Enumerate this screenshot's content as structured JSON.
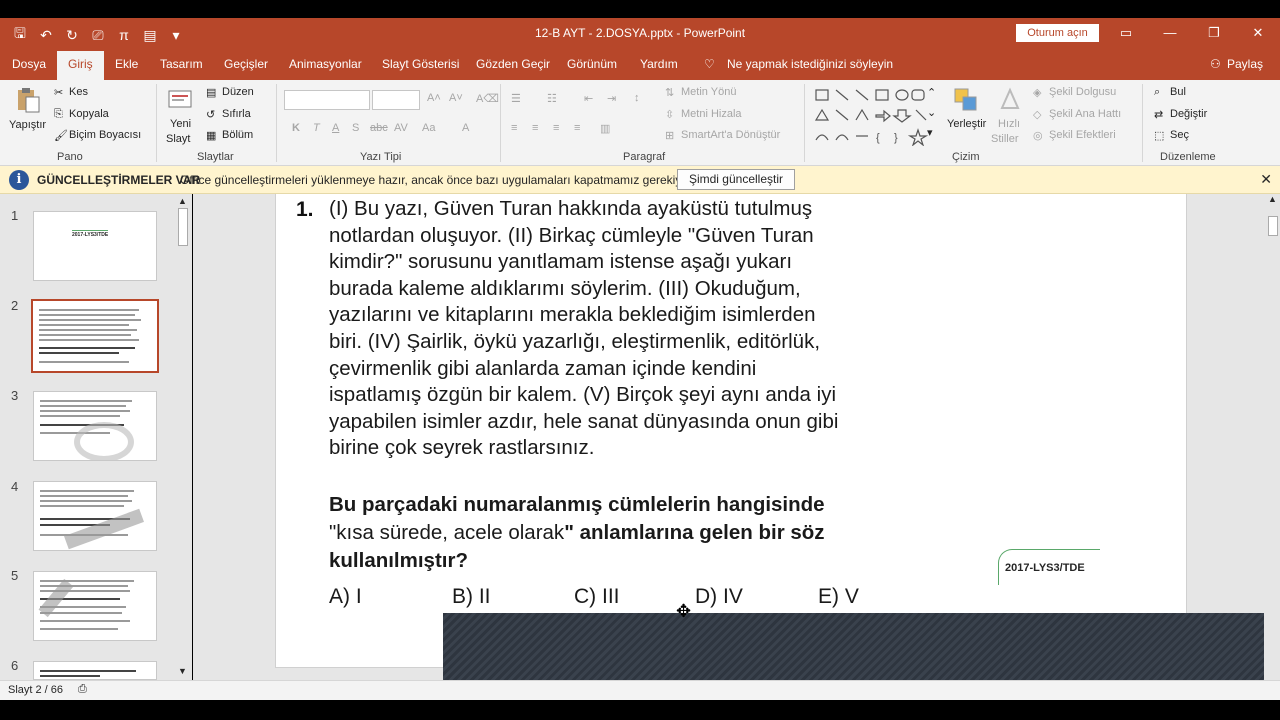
{
  "window": {
    "title": "12-B AYT - 2.DOSYA.pptx  -  PowerPoint",
    "signin_label": "Oturum açın",
    "controls": [
      "▭",
      "—",
      "❐",
      "✕"
    ]
  },
  "tabs": [
    "Dosya",
    "Giriş",
    "Ekle",
    "Tasarım",
    "Geçişler",
    "Animasyonlar",
    "Slayt Gösterisi",
    "Gözden Geçir",
    "Görünüm",
    "Yardım"
  ],
  "active_tab": "Giriş",
  "tell_me": "Ne yapmak istediğinizi söyleyin",
  "share_label": "Paylaş",
  "ribbon": {
    "pano": {
      "group": "Pano",
      "paste": "Yapıştır",
      "cut": "Kes",
      "copy": "Kopyala",
      "format_painter": "Biçim Boyacısı"
    },
    "slaytlar": {
      "group": "Slaytlar",
      "new_slide_1": "Yeni",
      "new_slide_2": "Slayt",
      "layout": "Düzen",
      "reset": "Sıfırla",
      "section": "Bölüm"
    },
    "yazi_tipi": {
      "group": "Yazı Tipi"
    },
    "paragraf": {
      "group": "Paragraf",
      "text_dir": "Metin Yönü",
      "align_text": "Metni Hizala",
      "smartart": "SmartArt'a Dönüştür"
    },
    "cizim": {
      "group": "Çizim",
      "arrange": "Yerleştir",
      "quick_styles_1": "Hızlı",
      "quick_styles_2": "Stiller",
      "shape_fill": "Şekil Dolgusu",
      "shape_outline": "Şekil Ana Hattı",
      "shape_effects": "Şekil Efektleri"
    },
    "duzenleme": {
      "group": "Düzenleme",
      "find": "Bul",
      "replace": "Değiştir",
      "select": "Seç"
    }
  },
  "infobar": {
    "title": "GÜNCELLEŞTİRMELER VAR",
    "message": "Office güncelleştirmeleri yüklenmeye hazır, ancak önce bazı uygulamaları kapatmamız gerekiyor.",
    "button": "Şimdi güncelleştir"
  },
  "thumbnails": {
    "numbers": [
      "1",
      "2",
      "3",
      "4",
      "5",
      "6"
    ],
    "first_tag": "2017-LYS3/TDE",
    "selected": 2
  },
  "slide": {
    "number": "1.",
    "text": "(I) Bu yazı, Güven Turan hakkında ayaküstü tutulmuş\nnotlardan oluşuyor. (II) Birkaç cümleyle \"Güven Turan\nkimdir?\" sorusunu yanıtlamam istense aşağı yukarı\nburada kaleme aldıklarımı söylerim. (III) Okuduğum,\nyazılarını ve kitaplarını merakla beklediğim isimlerden\nbiri. (IV) Şairlik, öykü yazarlığı, eleştirmenlik, editörlük,\nçevirmenlik gibi alanlarda zaman içinde kendini\nispatlamış özgün bir kalem. (V) Birçok şeyi aynı anda iyi\nyapabilen isimler azdır, hele sanat dünyasında onun gibi\nbirine çok seyrek rastlarsınız.",
    "prompt_a": "Bu parçadaki numaralanmış cümlelerin hangisinde",
    "prompt_b": "\"kısa sürede, acele olarak",
    "prompt_c": "\" anlamlarına gelen bir söz",
    "prompt_d": "kullanılmıştır?",
    "options": [
      "A)  I",
      "B)  II",
      "C) III",
      "D) IV",
      "E)  V"
    ],
    "tag": "2017-LYS3/TDE"
  },
  "status": {
    "slide_count": "Slayt 2 / 66"
  }
}
